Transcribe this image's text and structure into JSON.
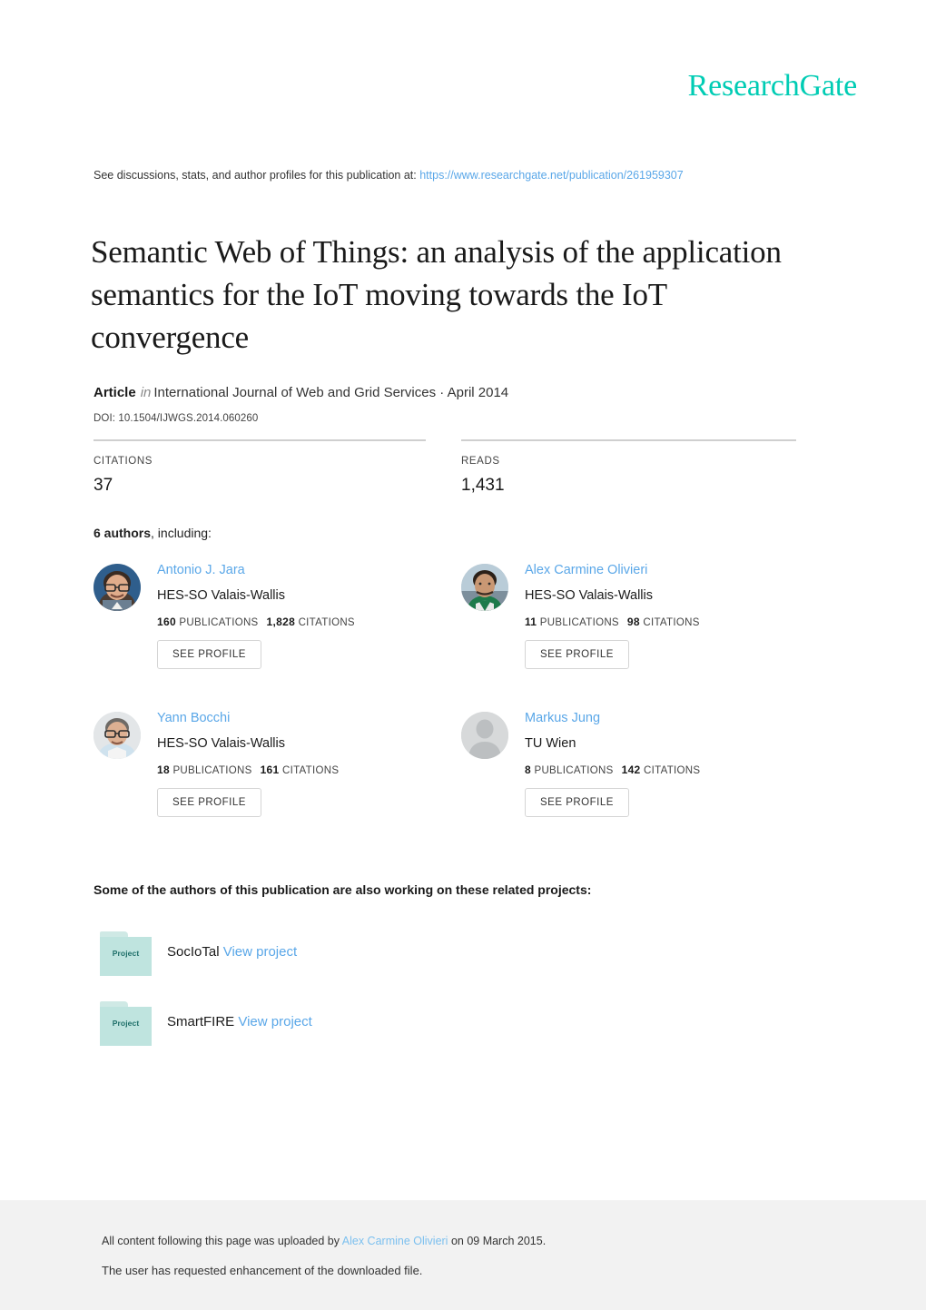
{
  "brand": {
    "logo_text": "ResearchGate",
    "logo_color": "#00ccb4",
    "link_color": "#5aa7e8"
  },
  "header": {
    "discussion_prefix": "See discussions, stats, and author profiles for this publication at: ",
    "discussion_url": "https://www.researchgate.net/publication/261959307"
  },
  "publication": {
    "title": "Semantic Web of Things: an analysis of the application semantics for the IoT moving towards the IoT convergence",
    "type_label": "Article",
    "in_label": "in",
    "venue": "International Journal of Web and Grid Services · April 2014",
    "doi": "DOI: 10.1504/IJWGS.2014.060260"
  },
  "stats": {
    "citations_label": "CITATIONS",
    "citations_value": "37",
    "reads_label": "READS",
    "reads_value": "1,431"
  },
  "authors_section": {
    "heading_bold": "6 authors",
    "heading_rest": ", including:",
    "see_profile_label": "SEE PROFILE",
    "publications_label": "PUBLICATIONS",
    "citations_label": "CITATIONS",
    "authors": [
      {
        "name": "Antonio J. Jara",
        "affiliation": "HES-SO Valais-Wallis",
        "publications": "160",
        "citations": "1,828",
        "avatar": "photo-male-glasses"
      },
      {
        "name": "Alex Carmine Olivieri",
        "affiliation": "HES-SO Valais-Wallis",
        "publications": "11",
        "citations": "98",
        "avatar": "photo-male-green-jacket"
      },
      {
        "name": "Yann Bocchi",
        "affiliation": "HES-SO Valais-Wallis",
        "publications": "18",
        "citations": "161",
        "avatar": "photo-male-blue-shirt"
      },
      {
        "name": "Markus Jung",
        "affiliation": "TU Wien",
        "publications": "8",
        "citations": "142",
        "avatar": "placeholder-silhouette"
      }
    ]
  },
  "projects_section": {
    "heading": "Some of the authors of this publication are also working on these related projects:",
    "folder_label": "Project",
    "view_label": "View project",
    "projects": [
      {
        "name": "SocIoTal"
      },
      {
        "name": "SmartFIRE"
      }
    ]
  },
  "footer": {
    "upload_prefix": "All content following this page was uploaded by ",
    "upload_user": "Alex Carmine Olivieri",
    "upload_suffix": " on 09 March 2015.",
    "enhancement_note": "The user has requested enhancement of the downloaded file."
  }
}
